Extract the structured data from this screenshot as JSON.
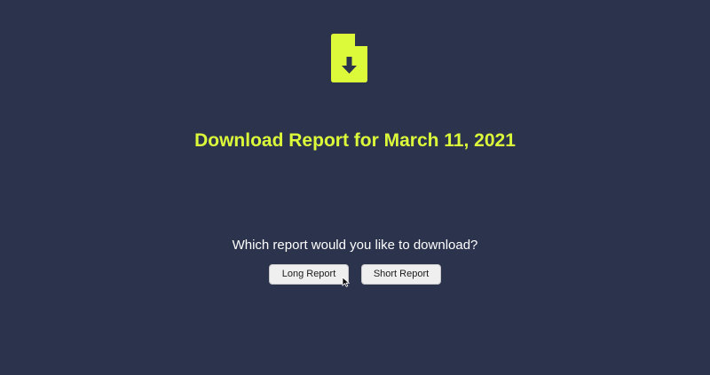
{
  "page": {
    "title": "Download Report for March 11, 2021",
    "question": "Which report would you like to download?",
    "icon": "file-download-icon"
  },
  "buttons": {
    "long_label": "Long Report",
    "short_label": "Short Report"
  },
  "colors": {
    "background": "#2b334d",
    "accent": "#dcfa3a",
    "text": "#ffffff",
    "button_bg": "#efeff0"
  }
}
